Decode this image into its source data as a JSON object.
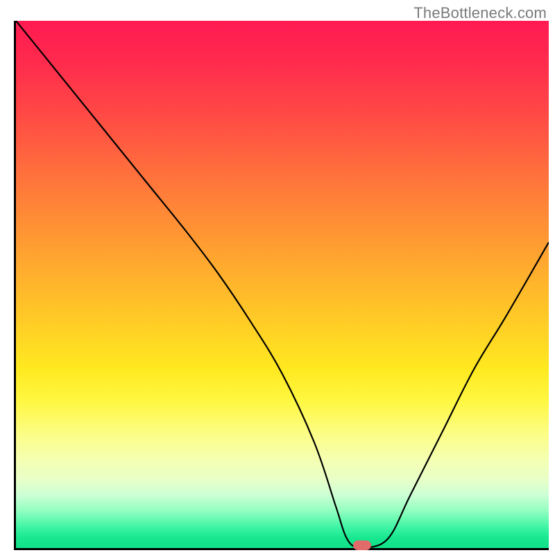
{
  "watermark": "TheBottleneck.com",
  "chart_data": {
    "type": "line",
    "title": "",
    "xlabel": "",
    "ylabel": "",
    "xlim": [
      0,
      100
    ],
    "ylim": [
      0,
      100
    ],
    "x": [
      0,
      8,
      16,
      24,
      32,
      38,
      44,
      50,
      56,
      60,
      62,
      64,
      66,
      70,
      74,
      80,
      86,
      92,
      100
    ],
    "values": [
      100,
      90,
      80,
      70,
      60,
      52,
      43,
      33,
      20,
      8,
      2,
      0,
      0,
      2,
      10,
      22,
      34,
      44,
      58
    ],
    "marker": {
      "x": 65,
      "y": 0
    },
    "gradient_stops": [
      {
        "pos": 0,
        "color": "#ff1a52"
      },
      {
        "pos": 38,
        "color": "#ff8e35"
      },
      {
        "pos": 66,
        "color": "#ffe920"
      },
      {
        "pos": 87,
        "color": "#e8ffc8"
      },
      {
        "pos": 100,
        "color": "#10e088"
      }
    ]
  }
}
